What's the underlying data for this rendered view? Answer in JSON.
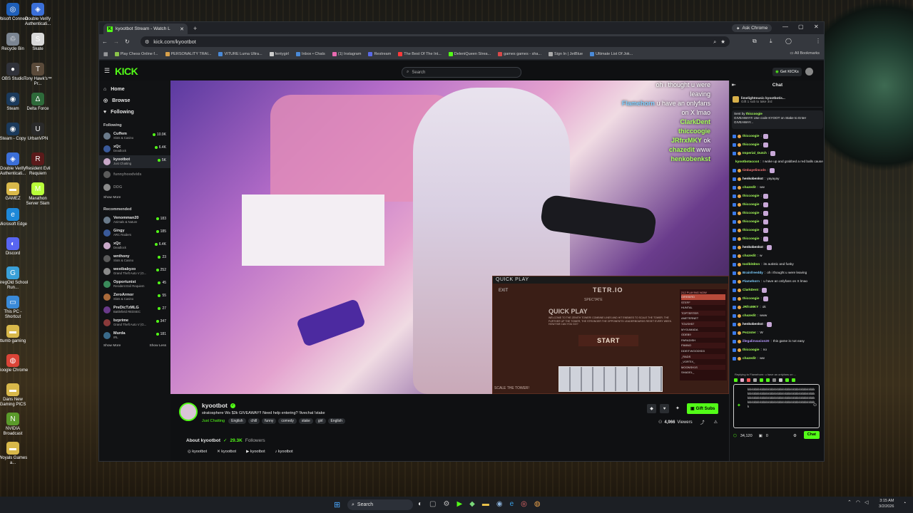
{
  "desktop": {
    "icons": [
      {
        "label": "Ubisoft Connect",
        "color": "#1f5fb8",
        "glyph": "◎"
      },
      {
        "label": "Double Verify Authenticati...",
        "color": "#3b6fd8",
        "glyph": "◈"
      },
      {
        "label": "Recycle Bin",
        "color": "#7b8592",
        "glyph": "♲"
      },
      {
        "label": "Skate",
        "color": "#d9d9d9",
        "glyph": "S"
      },
      {
        "label": "OBS Studio",
        "color": "#30323a",
        "glyph": "●"
      },
      {
        "label": "Tony Hawk's™ Pr...",
        "color": "#5a4a3a",
        "glyph": "T"
      },
      {
        "label": "Steam",
        "color": "#1b3a5c",
        "glyph": "◉"
      },
      {
        "label": "Delta Force",
        "color": "#2e6a3a",
        "glyph": "Δ"
      },
      {
        "label": "Steam - Copy",
        "color": "#1b3a5c",
        "glyph": "◉"
      },
      {
        "label": "UrbanVPN",
        "color": "#2a2a2a",
        "glyph": "U"
      },
      {
        "label": "Double Verify Authenticati...",
        "color": "#3b6fd8",
        "glyph": "◈"
      },
      {
        "label": "Resident Evil Requiem",
        "color": "#5a1a1a",
        "glyph": "R"
      },
      {
        "label": "GAMEZ",
        "color": "#d8b84a",
        "glyph": "▬"
      },
      {
        "label": "Marathon Server Slam",
        "color": "#b8ff3a",
        "glyph": "M"
      },
      {
        "label": "Microsoft Edge",
        "color": "#1e88d8",
        "glyph": "e"
      },
      {
        "label": "Discord",
        "color": "#5865f2",
        "glyph": "◐"
      },
      {
        "label": "GregOld School Run...",
        "color": "#3aa0d8",
        "glyph": "G"
      },
      {
        "label": "This PC - Shortcut",
        "color": "#3a8ad8",
        "glyph": "▭"
      },
      {
        "label": "ttumb gaming",
        "color": "#d8b84a",
        "glyph": "▬"
      },
      {
        "label": "Google Chrome",
        "color": "#db4437",
        "glyph": "◍"
      },
      {
        "label": "Dans New Gaming PICS",
        "color": "#d8b84a",
        "glyph": "▬"
      },
      {
        "label": "NVIDIA Broadcast",
        "color": "#5a9a2a",
        "glyph": "N"
      },
      {
        "label": "Woyals Games a...",
        "color": "#d8b84a",
        "glyph": "▬"
      }
    ]
  },
  "taskbar": {
    "search_label": "Search",
    "time": "3:15 AM",
    "date": "3/2/2026"
  },
  "browser": {
    "tab_title": "kyootbot Stream - Watch L",
    "ask_chrome": "Ask Chrome",
    "url": "kick.com/kyootbot",
    "bookmarks": [
      "Play Chess Online f...",
      "PERSONALITY TRAI...",
      "VITURE Luma Ultra...",
      "fentygirl",
      "Inbox • Chats",
      "(1) Instagram",
      "Restream",
      "The Best Of The Int...",
      "DeleniQueen Strea...",
      "games games - sha...",
      "Sign In | JetBlue",
      "Ultimate List Of Jok..."
    ],
    "all_bookmarks": "All Bookmarks"
  },
  "kick": {
    "logo": "KICK",
    "search_placeholder": "Search",
    "get_kicks": "Get KICKs",
    "nav": [
      {
        "label": "Home",
        "icon": "⌂"
      },
      {
        "label": "Browse",
        "icon": "◎"
      },
      {
        "label": "Following",
        "icon": "♥"
      }
    ],
    "following_title": "Following",
    "following": [
      {
        "name": "Cuffem",
        "cat": "Slots & Casino",
        "viewers": "10.9K",
        "live": true
      },
      {
        "name": "xQc",
        "cat": "Deadlock",
        "viewers": "6.4K",
        "live": true
      },
      {
        "name": "kyootbot",
        "cat": "Just Chatting",
        "viewers": "5K",
        "live": true
      },
      {
        "name": "funnyhoodvids",
        "cat": "",
        "viewers": "",
        "live": false
      },
      {
        "name": "DDG",
        "cat": "",
        "viewers": "",
        "live": false
      }
    ],
    "show_more": "Show More",
    "recommended_title": "Recommended",
    "recommended": [
      {
        "name": "Venomman20",
        "cat": "Animals & Nature",
        "viewers": "183"
      },
      {
        "name": "Gingy",
        "cat": "ARC Raiders",
        "viewers": "185"
      },
      {
        "name": "xQc",
        "cat": "Deadlock",
        "viewers": "6.4K"
      },
      {
        "name": "wnthony",
        "cat": "Slots & Casino",
        "viewers": "23"
      },
      {
        "name": "westbabyzo",
        "cat": "Grand Theft Auto V (G...",
        "viewers": "252"
      },
      {
        "name": "Opportunist",
        "cat": "Resident Evil Requiem",
        "viewers": "45"
      },
      {
        "name": "ZeroArmor",
        "cat": "Slots & Casino",
        "viewers": "55"
      },
      {
        "name": "PreDicTzMLG",
        "cat": "Battlefield REDSEC",
        "viewers": "27"
      },
      {
        "name": "bzprime",
        "cat": "Grand Theft Auto V (G...",
        "viewers": "347"
      },
      {
        "name": "Murda",
        "cat": "IRL",
        "viewers": "181"
      }
    ],
    "show_more_2": "Show More",
    "show_less": "Show Less",
    "video_overlay_chat": [
      {
        "name": "",
        "text": "oh i thought u were",
        "color": "#ffffff"
      },
      {
        "name": "",
        "text": "leaving",
        "color": "#ffffff"
      },
      {
        "name": "Flamehorn",
        "text": "u have an onlyfans",
        "color": "#7fd0ff"
      },
      {
        "name": "",
        "text": "on X lmao",
        "color": "#ffffff"
      },
      {
        "name": "ClarkDent",
        "text": "",
        "color": "#a8ff5a"
      },
      {
        "name": "thiccoogie",
        "text": "",
        "color": "#a8ff5a"
      },
      {
        "name": "JRfrxMKY",
        "text": "ok",
        "color": "#ffffff"
      },
      {
        "name": "chazedit",
        "text": "www",
        "color": "#ffffff"
      },
      {
        "name": "henkobenkst",
        "text": "",
        "color": "#ffffff"
      }
    ],
    "game": {
      "header": "QUICK PLAY",
      "exit": "EXIT",
      "spectate": "SPECTATE",
      "title": "QUICK PLAY",
      "tetr": "TETR.IO",
      "desc": "WELCOME TO THE ZENITH TOWER! COMBINE LINES AND HIT ENEMIES TO SCALE THE TOWER. THE FURTHER UP THE TOWER, THE STRONGER THE OPPONENTS! LEADERBOARDS RESET EVERY WEEK. HOW FAR CAN YOU GO?",
      "start": "START",
      "scale": "SCALE THE TOWER!",
      "players_label": "212 PLAYING NOW",
      "leaderboard": [
        "DIREBIRD",
        "STEFF",
        "HUNTAL",
        "TOPTERTER",
        "ANETERNET",
        "TOUSH57",
        "MYGUMADA",
        "ODEB9",
        "PARADISH",
        "FIMINO",
        "DDEIT:WOOD9D3",
        "_RADS",
        "_VORTIX_",
        "MOONSH1S",
        "SHADEL_"
      ]
    },
    "stream": {
      "name": "kyootbot",
      "title": "stratosphere Ws   $3k GIVEAWAY!! Need help entering? !livechat !stake",
      "category": "Just Chatting",
      "tags": [
        "English",
        "chill",
        "funny",
        "comedy",
        "stake",
        "girl",
        "English"
      ],
      "viewers": "4,966",
      "viewers_label": "Viewers",
      "gift_subs": "Gift Subs",
      "about": "About kyootbot",
      "followers": "29.3K",
      "followers_label": "Followers",
      "socials": [
        {
          "icon": "◎",
          "label": "kyootbot"
        },
        {
          "icon": "✕",
          "label": "kyootbot"
        },
        {
          "icon": "▶",
          "label": "kyootbot"
        },
        {
          "icon": "♪",
          "label": "kyootbot"
        }
      ]
    },
    "chat": {
      "title": "Chat",
      "pinned_user": "limelightmusic",
      "pinned_text": "kyootbotis...",
      "pinned_sub": "Gift 1 sub to take 3rd",
      "giveaway_by": "Sent by",
      "giveaway_user": "thiccoogie",
      "giveaway_text": "GIVEAWAY!! Use code KYOOT on Stake to Enter GIVEAWAY...",
      "messages": [
        {
          "user": "thiccoogie",
          "text": "",
          "color": "#a8ff5a"
        },
        {
          "user": "thiccoogie",
          "text": "",
          "color": "#a8ff5a"
        },
        {
          "user": "Imperial_Dutch",
          "text": "",
          "color": "#a8ff5a"
        },
        {
          "user": "kyootbotacco4",
          "text": "I woke up and grabbed a red balls cause I didnt go shopping yet",
          "color": "#a8ff5a"
        },
        {
          "user": "timbayelincoln",
          "text": "",
          "color": "#ff7a7a"
        },
        {
          "user": "henkobenkst",
          "text": "yayayay",
          "color": "#ffffff"
        },
        {
          "user": "chazedit",
          "text": "ww",
          "color": "#a8ff5a"
        },
        {
          "user": "thiccoogie",
          "text": "",
          "color": "#a8ff5a"
        },
        {
          "user": "thiccoogie",
          "text": "",
          "color": "#a8ff5a"
        },
        {
          "user": "thiccoogie",
          "text": "",
          "color": "#a8ff5a"
        },
        {
          "user": "thiccoogie",
          "text": "",
          "color": "#a8ff5a"
        },
        {
          "user": "thiccoogie",
          "text": "",
          "color": "#a8ff5a"
        },
        {
          "user": "thiccoogie",
          "text": "",
          "color": "#a8ff5a"
        },
        {
          "user": "henkobenkst",
          "text": "",
          "color": "#ffffff"
        },
        {
          "user": "chazedit",
          "text": "w",
          "color": "#a8ff5a"
        },
        {
          "user": "toolbitdmn",
          "text": "its autistic and funky",
          "color": "#a8ff5a"
        },
        {
          "user": "Brainfreeddy",
          "text": "oh i thought u were leaving",
          "color": "#7fd0ff"
        },
        {
          "user": "Flamehorn",
          "text": "u have an onlyfans on X lmao",
          "color": "#7fd0ff"
        },
        {
          "user": "ClarkDent",
          "text": "",
          "color": "#a8ff5a"
        },
        {
          "user": "thiccoogie",
          "text": "",
          "color": "#a8ff5a"
        },
        {
          "user": "JRfrxMKY",
          "text": "ok",
          "color": "#a8ff5a"
        },
        {
          "user": "chazedit",
          "text": "www",
          "color": "#a8ff5a"
        },
        {
          "user": "henkobenkst",
          "text": "",
          "color": "#ffffff"
        },
        {
          "user": "Pezzster",
          "text": "W",
          "color": "#a8ff5a"
        },
        {
          "user": "illegalinvasion20",
          "text": "this game is not easy",
          "color": "#b89aff"
        },
        {
          "user": "thiccoogie",
          "text": "no",
          "color": "#a8ff5a"
        },
        {
          "user": "chazedit",
          "text": "ww",
          "color": "#a8ff5a"
        }
      ],
      "reply_hint": "Replying to Flamehorn: u have an onlyfans on ...",
      "input_text": "kkkkkkkkkkkkkkkkkkkkkkkkkkkkkkkkkkkkkkkkkkkkkkkkkkkkkkkkkkkkkkkkkkkkkkkkkkkkkkkkkkkkkkkkkkkkkkkkkkkkkkkkkkkkkkkkkkkkkkkkkkkkkkkkkkkkkkkkkkkkkkkkkkkkkkkkkkkkkkkkkkkkkkkkkkkkk",
      "kicks_count": "34,120",
      "points": "0",
      "send_label": "Chat"
    }
  }
}
